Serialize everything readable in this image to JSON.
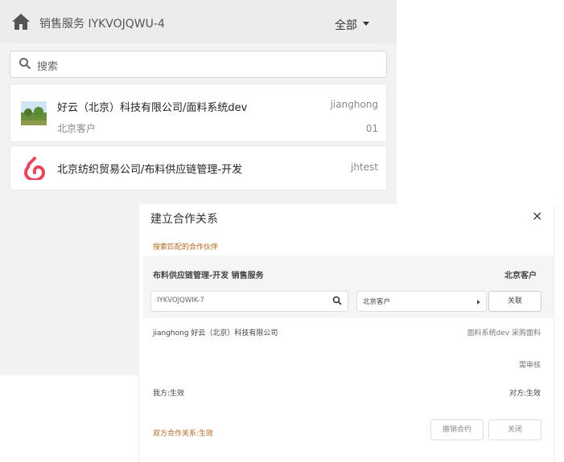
{
  "header": {
    "title": "销售服务 IYKVOJQWU-4",
    "filter_label": "全部"
  },
  "search": {
    "placeholder": "搜索"
  },
  "list": [
    {
      "title": "好云（北京）科技有限公司/面料系统dev",
      "subtitle": "北京客户",
      "user": "jianghong",
      "count": "01"
    },
    {
      "title": "北京纺织贸易公司/布料供应链管理-开发",
      "user": "jhtest"
    }
  ],
  "dialog": {
    "title": "建立合作关系",
    "close": "×",
    "subtitle": "搜索匹配的合作伙伴",
    "partner_name": "布料供应链管理-开发 销售服务",
    "client_type": "北京客户",
    "code_value": "IYKVOJQWIK-7",
    "select_value": "北京客户",
    "link_button": "关联",
    "row1_left": "jianghong 好云（北京）科技有限公司",
    "row1_right": "面料系统dev 采购面料",
    "pending": "需审核",
    "our_side": "我方:生效",
    "their_side": "对方:生效",
    "status": "双方合作关系:生效",
    "cancel_button": "撤销合约",
    "close_button": "关闭"
  },
  "colors": {
    "accent": "#b5651d",
    "logo_red": "#e8455f"
  }
}
